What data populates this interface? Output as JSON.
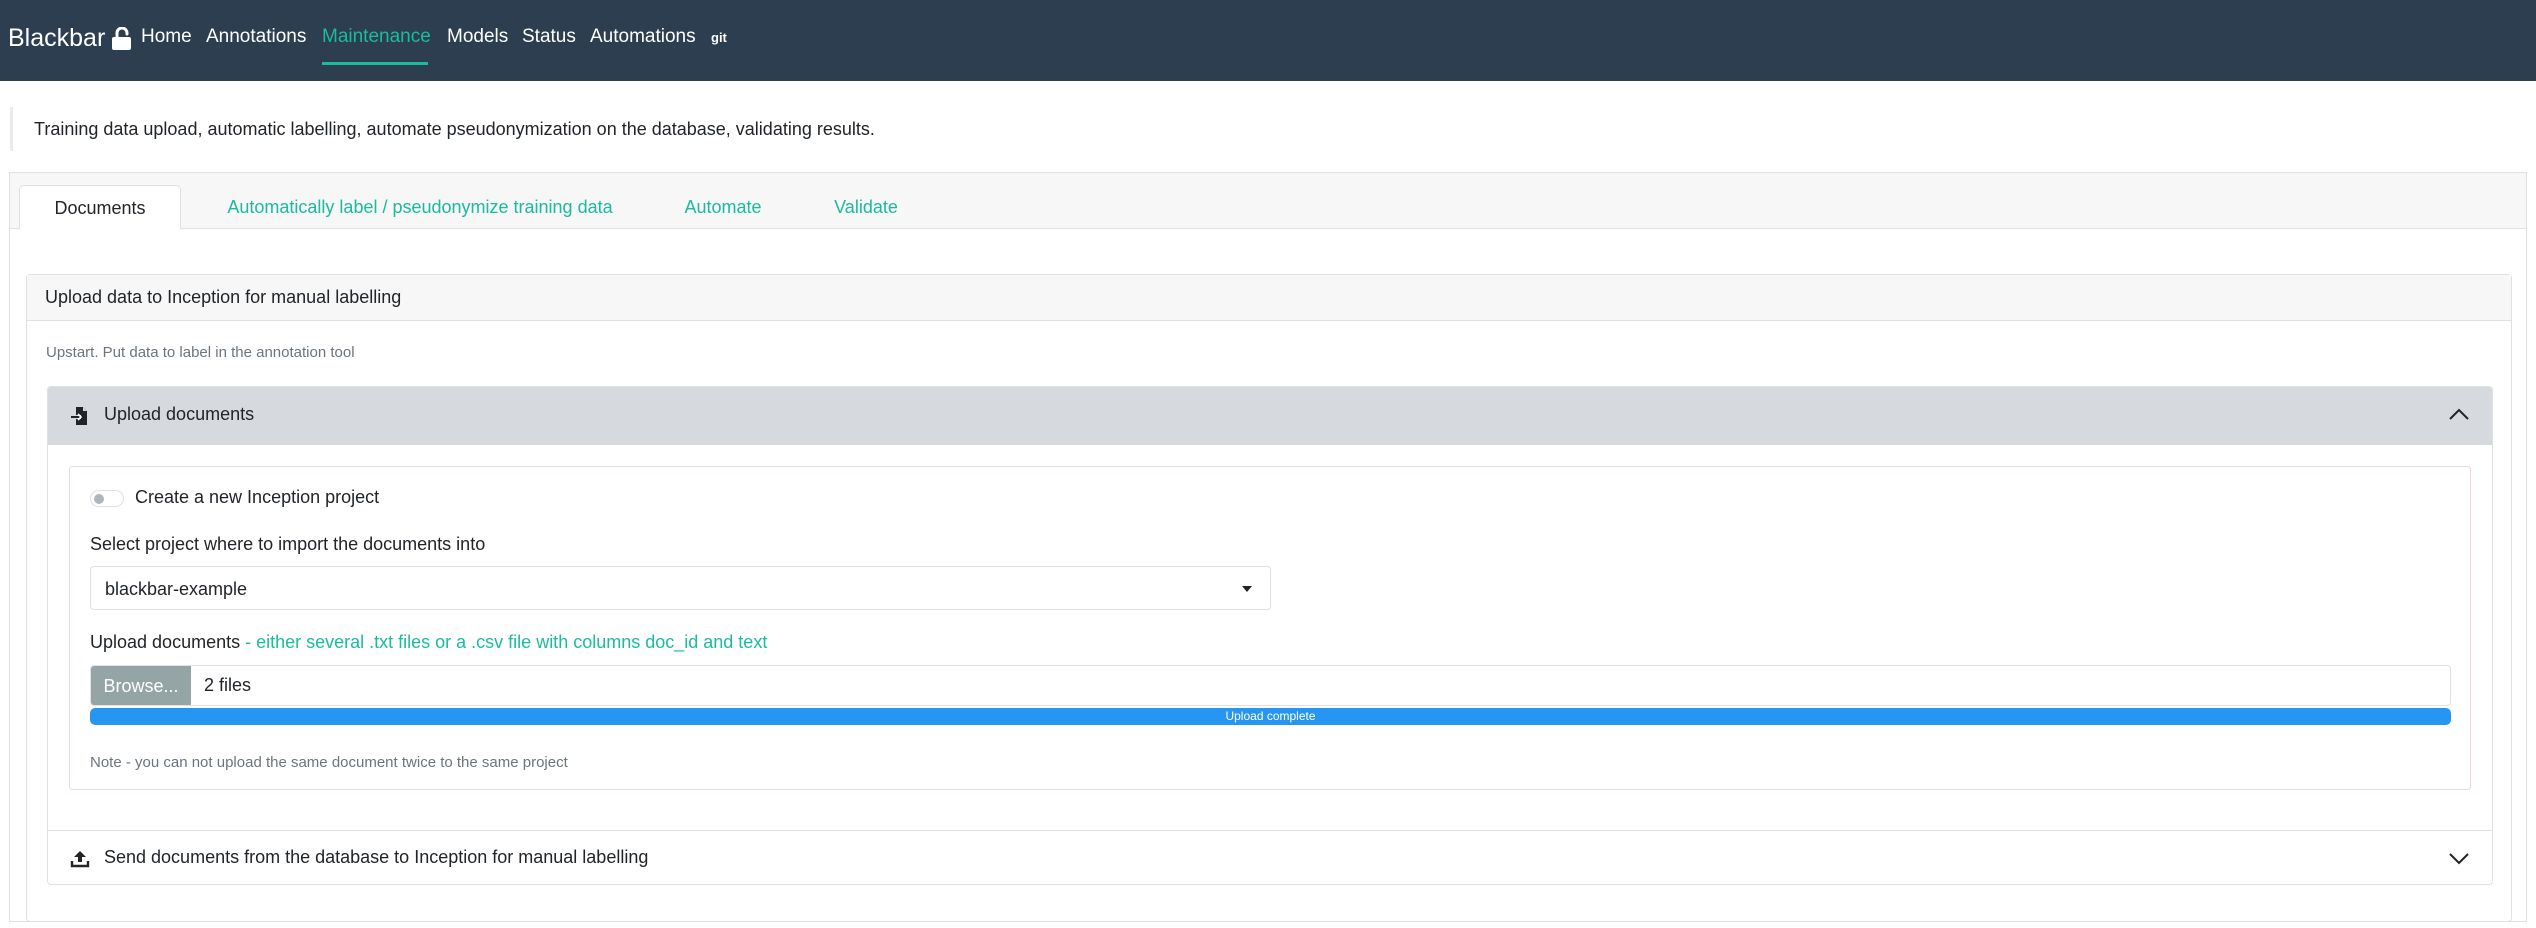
{
  "navbar": {
    "brand": "Blackbar",
    "items": [
      {
        "label": "Home"
      },
      {
        "label": "Annotations"
      },
      {
        "label": "Maintenance"
      },
      {
        "label": "Models"
      },
      {
        "label": "Status"
      },
      {
        "label": "Automations"
      }
    ],
    "git_label": "git",
    "active_item": "Maintenance"
  },
  "intro": "Training data upload, automatic labelling, automate pseudonymization on the database, validating results.",
  "tabs": [
    {
      "label": "Documents",
      "active": true
    },
    {
      "label": "Automatically label / pseudonymize training data",
      "active": false
    },
    {
      "label": "Automate",
      "active": false
    },
    {
      "label": "Validate",
      "active": false
    }
  ],
  "card": {
    "title": "Upload data to Inception for manual labelling",
    "subtitle": "Upstart. Put data to label in the annotation tool"
  },
  "accordion": {
    "upload": {
      "title": "Upload documents",
      "expanded": true,
      "toggle_label": "Create a new Inception project",
      "toggle_on": false,
      "select_label": "Select project where to import the documents into",
      "select_value": "blackbar-example",
      "upload_label_main": "Upload documents",
      "upload_label_hint": " - either several .txt files or a .csv file with columns doc_id and text",
      "browse_label": "Browse...",
      "file_value": "2 files",
      "progress_text": "Upload complete",
      "progress_fraction": 1.0,
      "note": "Note - you can not upload the same document twice to the same project"
    },
    "send": {
      "title": "Send documents from the database to Inception for manual labelling",
      "expanded": false
    }
  },
  "colors": {
    "navbar_bg": "#2c3e50",
    "accent": "#1abc9c",
    "progress": "#2796f3",
    "browse_bg": "#95a5a6"
  },
  "icons": {
    "brand": "lock-open-icon",
    "upload_documents": "file-import-icon",
    "send_documents": "upload-icon",
    "collapse": "chevron-up-icon",
    "expand": "chevron-down-icon"
  }
}
